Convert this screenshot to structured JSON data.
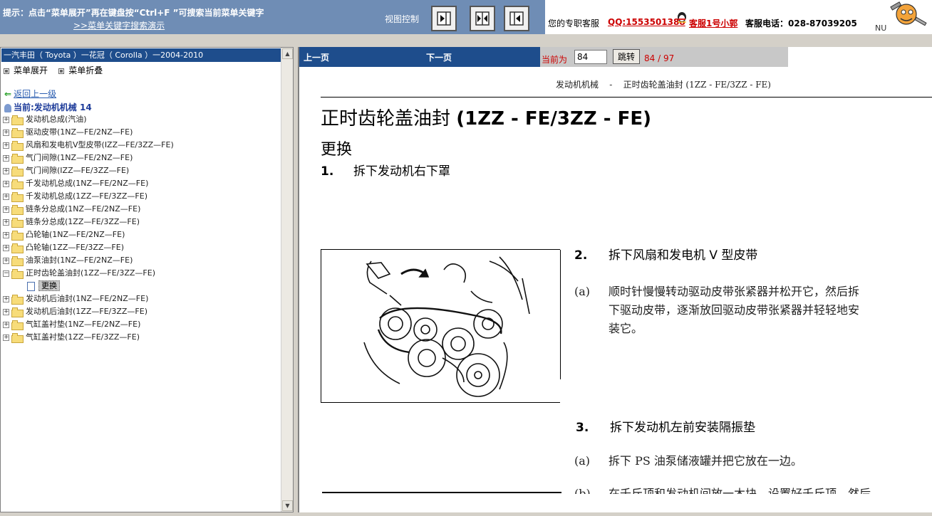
{
  "topbar": {
    "tip_line1": "提示：点击“菜单展开”再在键盘按“Ctrl+F ”可搜索当前菜单关键字",
    "tip_link": ">>菜单关键字搜索演示",
    "view_label": "视图控制",
    "view_buttons": [
      "show-right",
      "split",
      "show-left"
    ]
  },
  "customer_service": {
    "label": "您的专职客服",
    "qq": "QQ:1553501388",
    "agent": "客服1号小郭",
    "phone": "客服电话：028-87039205"
  },
  "logo": {
    "text": "NU"
  },
  "left": {
    "breadcrumb": "一汽丰田（ Toyota ）一花冠（ Corolla ）一2004-2010",
    "menu_expand": "菜单展开",
    "menu_collapse": "菜单折叠",
    "back": "返回上一级",
    "current": "当前:发动机机械  14",
    "tree": [
      {
        "label": "发动机总成(汽油)",
        "expanded": false
      },
      {
        "label": "驱动皮带(1NZ—FE/2NZ—FE)",
        "expanded": false
      },
      {
        "label": "风扇和发电机V型皮带(IZZ—FE/3ZZ—FE)",
        "expanded": false
      },
      {
        "label": "气门间隙(1NZ—FE/2NZ—FE)",
        "expanded": false
      },
      {
        "label": "气门间隙(IZZ—FE/3ZZ—FE)",
        "expanded": false
      },
      {
        "label": "千发动机总成(1NZ—FE/2NZ—FE)",
        "expanded": false
      },
      {
        "label": "千发动机总成(1ZZ—FE/3ZZ—FE)",
        "expanded": false
      },
      {
        "label": "链条分总成(1NZ—FE/2NZ—FE)",
        "expanded": false
      },
      {
        "label": "链条分总成(1ZZ—FE/3ZZ—FE)",
        "expanded": false
      },
      {
        "label": "凸轮轴(1NZ—FE/2NZ—FE)",
        "expanded": false
      },
      {
        "label": "凸轮轴(1ZZ—FE/3ZZ—FE)",
        "expanded": false
      },
      {
        "label": "油泵油封(1NZ—FE/2NZ—FE)",
        "expanded": false
      },
      {
        "label": "正时齿轮盖油封(1ZZ—FE/3ZZ—FE)",
        "expanded": true,
        "child": "更换"
      },
      {
        "label": "发动机后油封(1NZ—FE/2NZ—FE)",
        "expanded": false
      },
      {
        "label": "发动机后油封(1ZZ—FE/3ZZ—FE)",
        "expanded": false
      },
      {
        "label": "气缸盖衬垫(1NZ—FE/2NZ—FE)",
        "expanded": false
      },
      {
        "label": "气缸盖衬垫(1ZZ—FE/3ZZ—FE)",
        "expanded": false
      }
    ]
  },
  "nav": {
    "prev": "上一页",
    "next": "下一页",
    "current_label": "当前为",
    "page_value": "84",
    "go_label": "跳转",
    "page_count": "84 / 97"
  },
  "document": {
    "header_section": "发动机机械",
    "header_sep": "-",
    "header_topic": "正时齿轮盖油封 (1ZZ - FE/3ZZ - FE)",
    "title_cn": "正时齿轮盖油封",
    "title_code": "(1ZZ - FE/3ZZ - FE)",
    "subtitle": "更换",
    "steps": [
      {
        "num": "1.",
        "text": "拆下发动机右下罩"
      },
      {
        "num": "2.",
        "text": "拆下风扇和发电机 V 型皮带"
      },
      {
        "num": "3.",
        "text": "拆下发动机左前安装隔振垫"
      }
    ],
    "step2_sub": {
      "label": "(a)",
      "lines": [
        "顺时针慢慢转动驱动皮带张紧器并松开它，然后拆",
        "下驱动皮带，逐渐放回驱动皮带张紧器并轻轻地安",
        "装它。"
      ]
    },
    "step3_sub": {
      "label": "(a)",
      "text": "拆下 PS 油泵储液罐并把它放在一边。"
    },
    "step3_sub_b": {
      "label": "(b)",
      "text": "在千斤顶和发动机间放一木块，设置好千斤顶，然后"
    }
  }
}
